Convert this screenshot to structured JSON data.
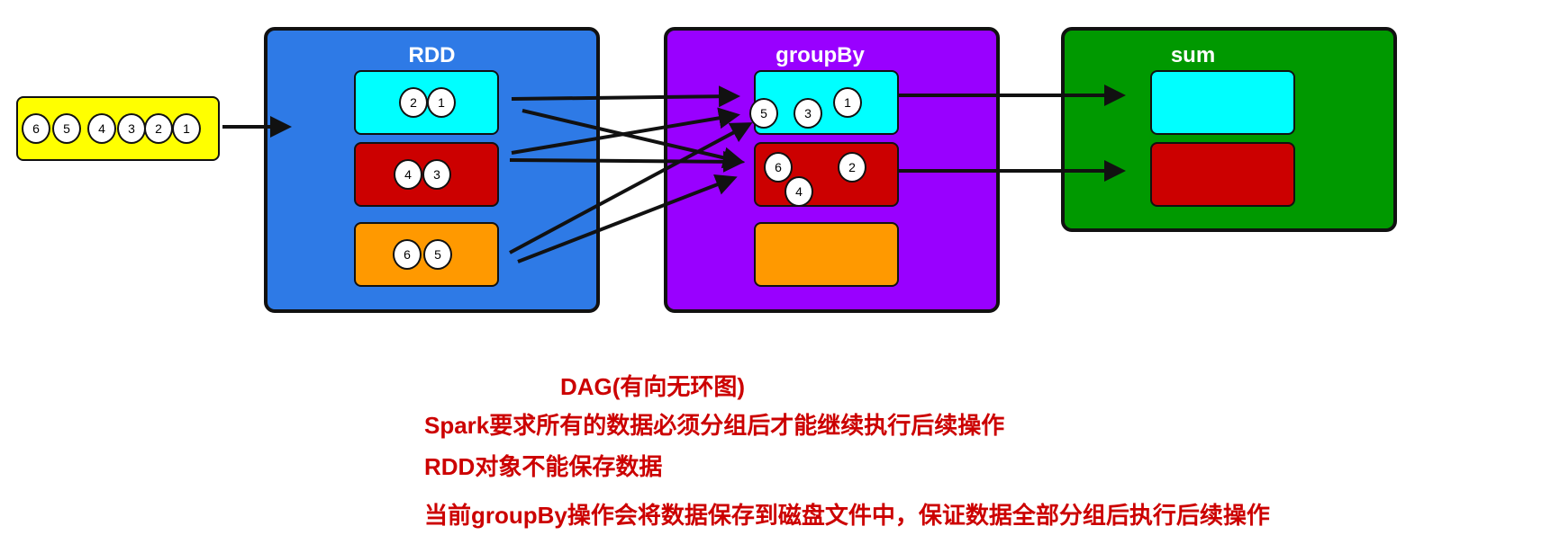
{
  "colors": {
    "source": "#ffff00",
    "rdd": "#2e7ae6",
    "groupby": "#9900ff",
    "sum": "#009900",
    "cyan": "#00ffff",
    "red": "#cc0000",
    "orange": "#ff9900",
    "note": "#cc0000"
  },
  "source": {
    "balls": [
      "6",
      "5",
      "4",
      "3",
      "2",
      "1"
    ]
  },
  "rdd": {
    "title": "RDD",
    "partitions": [
      {
        "balls": [
          "2",
          "1"
        ]
      },
      {
        "balls": [
          "4",
          "3"
        ]
      },
      {
        "balls": [
          "6",
          "5"
        ]
      }
    ]
  },
  "groupby": {
    "title": "groupBy",
    "partitions": [
      {
        "balls": [
          "5",
          "3",
          "1"
        ]
      },
      {
        "balls": [
          "6",
          "2",
          "4"
        ]
      },
      {
        "balls": []
      }
    ]
  },
  "sum": {
    "title": "sum",
    "partitions": [
      {},
      {}
    ]
  },
  "notes": [
    "DAG(有向无环图)",
    "Spark要求所有的数据必须分组后才能继续执行后续操作",
    "RDD对象不能保存数据",
    "当前groupBy操作会将数据保存到磁盘文件中，保证数据全部分组后执行后续操作"
  ]
}
